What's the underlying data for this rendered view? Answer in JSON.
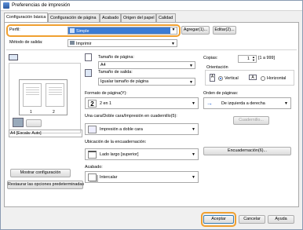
{
  "window": {
    "title": "Preferencias de impresión"
  },
  "tabs": [
    {
      "label": "Configuración básica"
    },
    {
      "label": "Configuración de página"
    },
    {
      "label": "Acabado"
    },
    {
      "label": "Origen del papel"
    },
    {
      "label": "Calidad"
    }
  ],
  "profile": {
    "label": "Perfil:",
    "value": "Simple",
    "add_label": "Agregar(1)...",
    "edit_label": "Editar(2)..."
  },
  "output": {
    "label": "Método de salida:",
    "value": "Imprimir"
  },
  "preview": {
    "status": "A4 [Escala: Auto]",
    "show_config_label": "Mostrar configuración",
    "restore_label": "Restaurar las opciones predeterminadas"
  },
  "page_size": {
    "label": "Tamaño de página:",
    "value": "A4"
  },
  "output_size": {
    "label": "Tamaño de salida:",
    "value": "Igualar tamaño de página"
  },
  "copies": {
    "label": "Copias:",
    "value": "1",
    "range": "[1 a 999]"
  },
  "orientation": {
    "label": "Orientación",
    "vertical": "Vertical",
    "horizontal": "Horizontal"
  },
  "page_format": {
    "label": "Formato de página(Y):",
    "value": "2 en 1",
    "icon_num": "2"
  },
  "page_order": {
    "label": "Orden de páginas:",
    "value": "De izquierda a derecha"
  },
  "duplex": {
    "label": "Una cara/Doble cara/Impresión en cuadernillo(5):",
    "value": "Impresión a doble cara",
    "booklet_label": "Cuadernillo..."
  },
  "binding": {
    "label": "Ubicación de la encuadernación:",
    "value": "Lado largo [superior]",
    "binding_btn": "Encuadernación(6)..."
  },
  "finishing": {
    "label": "Acabado:",
    "value": "Intercalar"
  },
  "footer": {
    "ok": "Aceptar",
    "cancel": "Cancelar",
    "help": "Ayuda"
  }
}
